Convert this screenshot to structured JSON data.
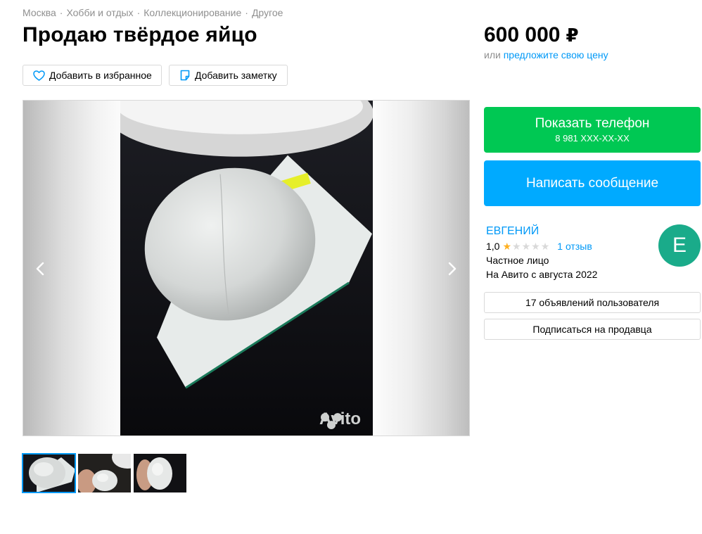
{
  "breadcrumb": [
    "Москва",
    "Хобби и отдых",
    "Коллекционирование",
    "Другое"
  ],
  "breadcrumb_sep": "·",
  "title": "Продаю твёрдое яйцо",
  "price": {
    "amount": "600 000",
    "currency": "₽",
    "offer_prefix": "или",
    "offer_link": "предложите свою цену"
  },
  "actions": {
    "favorite": "Добавить в избранное",
    "note": "Добавить заметку"
  },
  "gallery": {
    "watermark": "Avito",
    "thumbnails_count": 3,
    "active_thumbnail": 1
  },
  "contact": {
    "phone_label": "Показать телефон",
    "phone_number": "8 981 XXX-XX-XX",
    "message_label": "Написать сообщение"
  },
  "seller": {
    "name": "ЕВГЕНИЙ",
    "rating": "1,0",
    "stars_filled": 1,
    "stars_total": 5,
    "reviews": "1 отзыв",
    "type": "Частное лицо",
    "since": "На Авито с августа 2022",
    "avatar_letter": "E",
    "listings_button": "17 объявлений пользователя",
    "subscribe_button": "Подписаться на продавца"
  },
  "colors": {
    "link": "#0099f7",
    "phone_button": "#00c853",
    "message_button": "#00aaff",
    "avatar": "#1aab8a",
    "star": "#ffb020"
  }
}
